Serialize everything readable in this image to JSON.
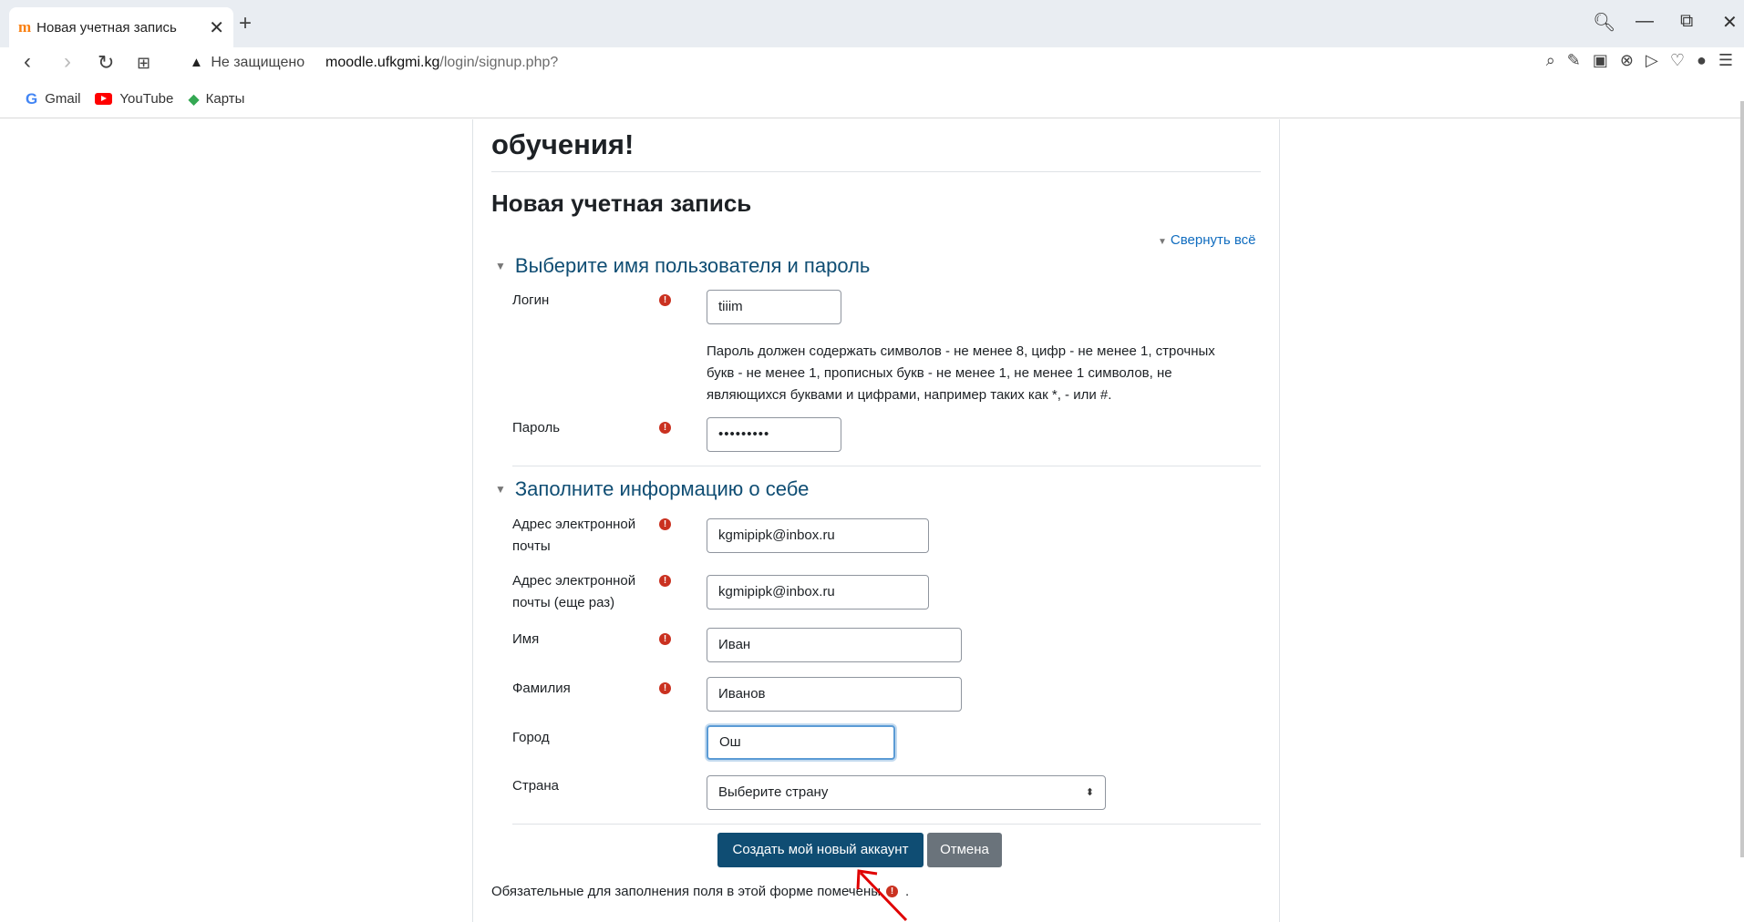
{
  "browser": {
    "tab_title": "Новая учетная запись",
    "tab_favicon": "m",
    "new_tab": "+",
    "tab_close": "✕",
    "security_label": "Не защищено",
    "url_host": "moodle.ufkgmi.kg",
    "url_path": "/login/signup.php?",
    "bookmarks": [
      "Gmail",
      "YouTube",
      "Карты"
    ]
  },
  "page": {
    "heading_fragment": "обучения!",
    "title": "Новая учетная запись",
    "collapse_all": "Свернуть всё",
    "section1": {
      "legend": "Выберите имя пользователя и пароль",
      "login_label": "Логин",
      "login_value": "tiiim",
      "password_help": "Пароль должен содержать символов - не менее 8, цифр - не менее 1, строчных букв - не менее 1, прописных букв - не менее 1, не менее 1 символов, не являющихся буквами и цифрами, например таких как *, - или #.",
      "password_label": "Пароль",
      "password_value": "•••••••••"
    },
    "section2": {
      "legend": "Заполните информацию о себе",
      "email_label_1": "Адрес электронной",
      "email_label_2": "почты",
      "email_value": "kgmipipk@inbox.ru",
      "email2_label_1": "Адрес электронной",
      "email2_label_2": "почты (еще раз)",
      "email2_value": "kgmipipk@inbox.ru",
      "firstname_label": "Имя",
      "firstname_value": "Иван",
      "lastname_label": "Фамилия",
      "lastname_value": "Иванов",
      "city_label": "Город",
      "city_value": "Ош",
      "country_label": "Страна",
      "country_value": "Выберите страну"
    },
    "submit_label": "Создать мой новый аккаунт",
    "cancel_label": "Отмена",
    "required_note": "Обязательные для заполнения поля в этой форме помечены",
    "required_note_end": "."
  },
  "colors": {
    "primary_button": "#0f4d73",
    "secondary_button": "#6a737b",
    "required_icon": "#ca3120",
    "annotation_arrow": "#e00000"
  }
}
